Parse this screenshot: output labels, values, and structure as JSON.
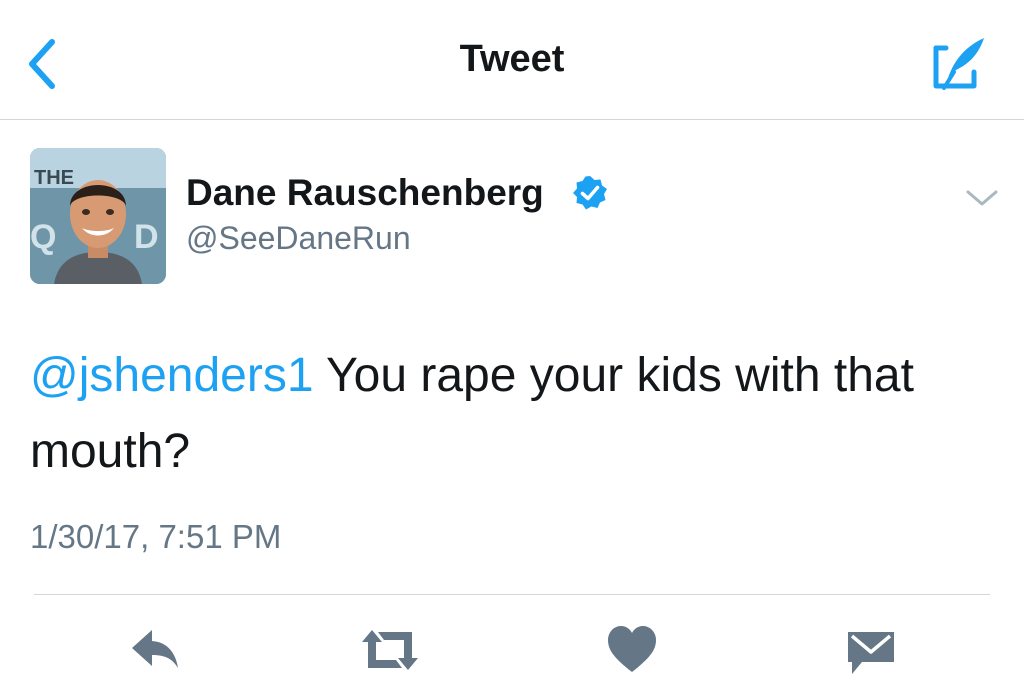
{
  "nav": {
    "title": "Tweet",
    "back_icon": "chevron-left-icon",
    "compose_icon": "compose-feather-icon",
    "accent": "#1da1f2"
  },
  "author": {
    "name": "Dane Rauschenberg",
    "handle": "@SeeDaneRun",
    "verified": true,
    "avatar_backdrop_text": "THE QUAD"
  },
  "tweet": {
    "mention": "@jshenders1",
    "text": " You rape your kids with that mouth?",
    "timestamp": "1/30/17, 7:51 PM"
  },
  "actions": {
    "items": [
      "reply-icon",
      "retweet-icon",
      "like-heart-icon",
      "direct-message-icon"
    ],
    "icon_color": "#657786"
  },
  "colors": {
    "text": "#14171a",
    "secondary": "#657786",
    "divider": "#d6d6d6",
    "link": "#1da1f2"
  }
}
